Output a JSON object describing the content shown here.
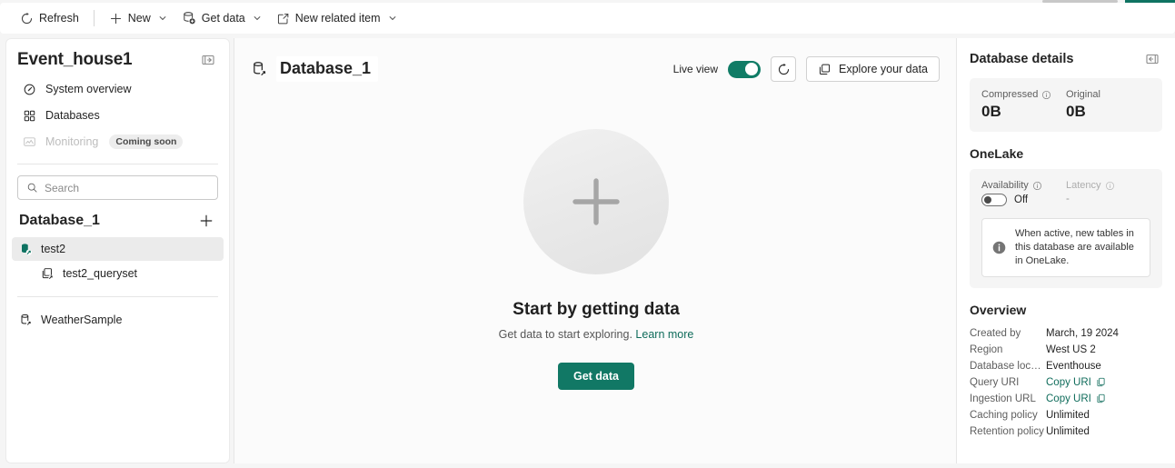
{
  "toolbar": {
    "items": [
      {
        "label": "Refresh",
        "icon": "refresh-icon",
        "caret": false
      },
      {
        "label": "New",
        "icon": "plus-icon",
        "caret": true
      },
      {
        "label": "Get data",
        "icon": "get-data-icon",
        "caret": true
      },
      {
        "label": "New related item",
        "icon": "external-link-icon",
        "caret": true
      }
    ]
  },
  "sidebar": {
    "title": "Event_house1",
    "collapse_icon": "panel-collapse-icon",
    "nav": [
      {
        "label": "System overview",
        "icon": "gauge-icon",
        "disabled": false,
        "badge": ""
      },
      {
        "label": "Databases",
        "icon": "grid-icon",
        "disabled": false,
        "badge": ""
      },
      {
        "label": "Monitoring",
        "icon": "monitor-icon",
        "disabled": true,
        "badge": "Coming soon"
      }
    ],
    "search": {
      "placeholder": "Search",
      "value": "",
      "icon": "search-icon"
    },
    "database_group": {
      "title": "Database_1",
      "add_icon": "plus-icon",
      "items": [
        {
          "label": "test2",
          "icon": "database-shortcut-icon",
          "selected": true,
          "indent": false
        },
        {
          "label": "test2_queryset",
          "icon": "queryset-icon",
          "selected": false,
          "indent": true
        }
      ],
      "other_items": [
        {
          "label": "WeatherSample",
          "icon": "database-shortcut-icon",
          "selected": false,
          "indent": false
        }
      ]
    }
  },
  "main": {
    "title": "Database_1",
    "title_icon": "database-shortcut-icon",
    "live_view_label": "Live view",
    "live_view_on": true,
    "refresh_icon": "refresh-icon",
    "explore_button": {
      "label": "Explore your data",
      "icon": "copy-stack-icon"
    },
    "empty_state": {
      "circle_icon": "plus-icon",
      "title": "Start by getting data",
      "subtitle": "Get data to start exploring.",
      "link": "Learn more",
      "button": "Get data"
    }
  },
  "details": {
    "title": "Database details",
    "collapse_icon": "panel-expand-icon",
    "stats": [
      {
        "label": "Compressed",
        "info": true,
        "value": "0B"
      },
      {
        "label": "Original",
        "info": false,
        "value": "0B"
      }
    ],
    "onelake": {
      "section_title": "OneLake",
      "availability_label": "Availability",
      "availability_value": "Off",
      "availability_on": false,
      "latency_label": "Latency",
      "latency_value": "-",
      "info_icon": "info-filled-icon",
      "info_text": "When active, new tables in this database are available in OneLake."
    },
    "overview": {
      "section_title": "Overview",
      "rows": [
        {
          "key": "Created by",
          "value": "March, 19 2024",
          "type": "text"
        },
        {
          "key": "Region",
          "value": "West US 2",
          "type": "text"
        },
        {
          "key": "Database locati...",
          "value": "Eventhouse",
          "type": "text"
        },
        {
          "key": "Query URI",
          "value": "Copy URI",
          "type": "copy"
        },
        {
          "key": "Ingestion URL",
          "value": "Copy URI",
          "type": "copy"
        },
        {
          "key": "Caching policy",
          "value": "Unlimited",
          "type": "text"
        },
        {
          "key": "Retention policy",
          "value": "Unlimited",
          "type": "text"
        }
      ]
    }
  },
  "colors": {
    "accent": "#117865",
    "link": "#0f6c5b",
    "panel_bg": "#ffffff",
    "page_bg": "#f5f5f5"
  }
}
